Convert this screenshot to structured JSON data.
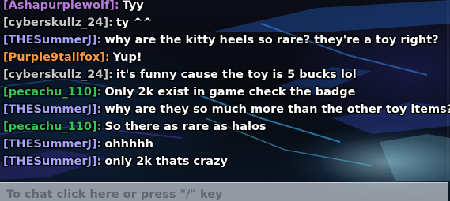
{
  "chat": {
    "messages": [
      {
        "author": "[Ashapurplewolf]:",
        "author_color": "#b57edc",
        "text": "Tyy"
      },
      {
        "author": "[cyberskullz_24]:",
        "author_color": "#c8c8c8",
        "text": "ty ^^"
      },
      {
        "author": "[THESummerJ]:",
        "author_color": "#a4a4ff",
        "text": "why are the kitty heels so rare? they're a toy right?"
      },
      {
        "author": "[Purple9tailfox]:",
        "author_color": "#ff9a3c",
        "text": "Yup!"
      },
      {
        "author": "[cyberskullz_24]:",
        "author_color": "#c8c8c8",
        "text": "it's funny cause the toy is 5 bucks lol"
      },
      {
        "author": "[pecachu_110]:",
        "author_color": "#35c35a",
        "text": "Only 2k exist in game check the badge"
      },
      {
        "author": "[THESummerJ]:",
        "author_color": "#a4a4ff",
        "text": "why are they so much more than the other toy items?"
      },
      {
        "author": "[pecachu_110]:",
        "author_color": "#35c35a",
        "text": "So there as rare as halos"
      },
      {
        "author": "[THESummerJ]:",
        "author_color": "#a4a4ff",
        "text": "ohhhhh"
      },
      {
        "author": "[THESummerJ]:",
        "author_color": "#a4a4ff",
        "text": "only 2k thats crazy"
      }
    ],
    "input": {
      "placeholder": "To chat click here or press \"/\" key"
    }
  }
}
